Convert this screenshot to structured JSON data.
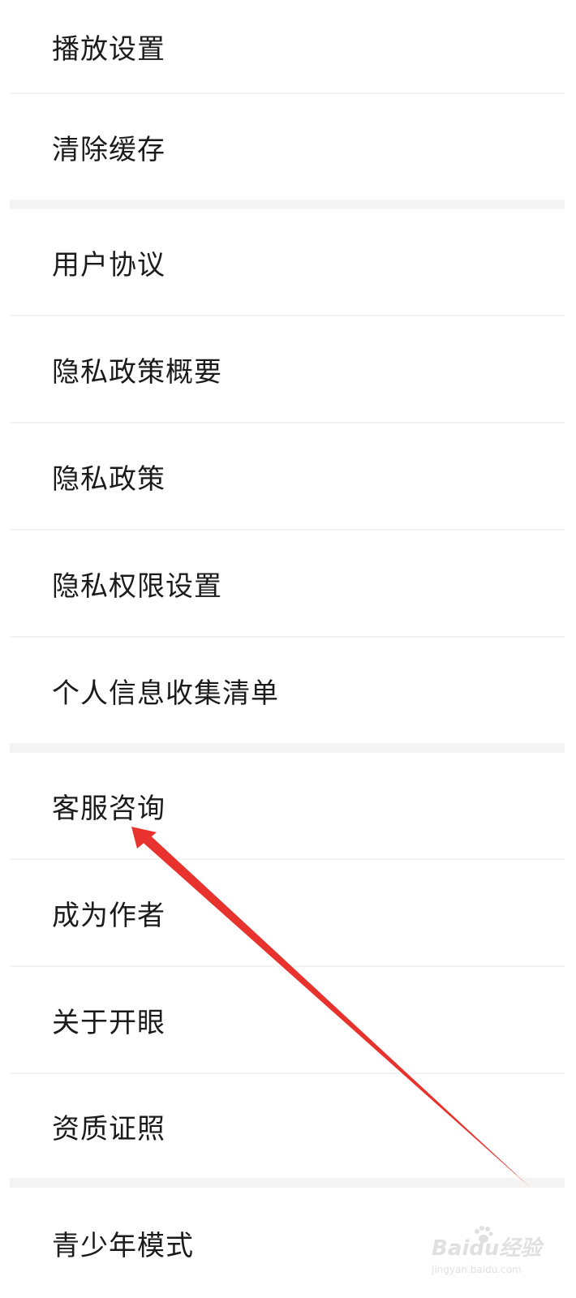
{
  "settings": {
    "items": [
      {
        "label": "播放设置"
      },
      {
        "label": "清除缓存"
      },
      {
        "label": "用户协议"
      },
      {
        "label": "隐私政策概要"
      },
      {
        "label": "隐私政策"
      },
      {
        "label": "隐私权限设置"
      },
      {
        "label": "个人信息收集清单"
      },
      {
        "label": "客服咨询"
      },
      {
        "label": "成为作者"
      },
      {
        "label": "关于开眼"
      },
      {
        "label": "资质证照"
      },
      {
        "label": "青少年模式"
      }
    ]
  },
  "annotation": {
    "arrow_color": "#e8322e"
  },
  "watermark": {
    "brand": "Baidu经验",
    "url": "jingyan.baidu.com"
  }
}
